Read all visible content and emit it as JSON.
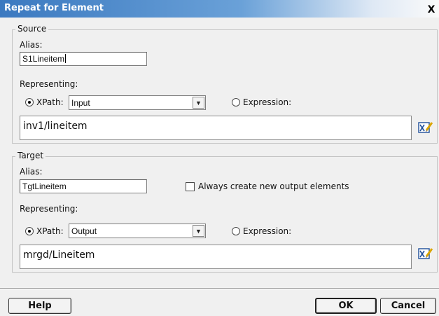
{
  "window": {
    "title": "Repeat for Element",
    "close_glyph": "X"
  },
  "source": {
    "legend": "Source",
    "alias_label": "Alias:",
    "alias_value": "S1Lineitem",
    "representing_label": "Representing:",
    "xpath_label": "XPath:",
    "xpath_selected": "Input",
    "xpath_checked": true,
    "expression_label": "Expression:",
    "expression_checked": false,
    "path_value": "inv1/lineitem",
    "edit_icon": "edit-expression-icon"
  },
  "target": {
    "legend": "Target",
    "alias_label": "Alias:",
    "alias_value": "TgtLineitem",
    "always_create_label": "Always create new output elements",
    "always_create_checked": false,
    "representing_label": "Representing:",
    "xpath_label": "XPath:",
    "xpath_selected": "Output",
    "xpath_checked": true,
    "expression_label": "Expression:",
    "expression_checked": false,
    "path_value": "mrgd/Lineitem",
    "edit_icon": "edit-expression-icon"
  },
  "buttons": {
    "help": "Help",
    "ok": "OK",
    "cancel": "Cancel"
  },
  "colors": {
    "titlebar_start": "#3b79c0",
    "dialog_bg": "#f0f0f0"
  }
}
